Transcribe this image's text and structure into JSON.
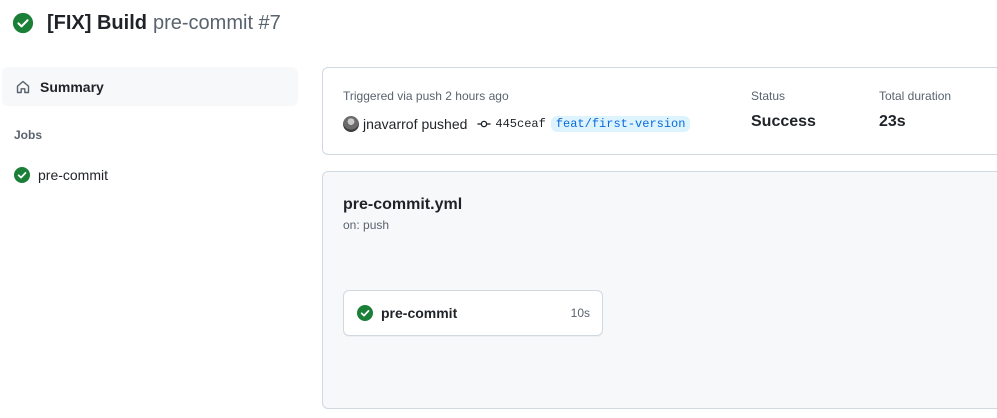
{
  "header": {
    "title": "[FIX] Build",
    "subtitle": "pre-commit #7",
    "status_icon": "check-circle-fill-icon"
  },
  "sidebar": {
    "summary_label": "Summary",
    "jobs_heading": "Jobs",
    "jobs": [
      {
        "label": "pre-commit",
        "status": "success"
      }
    ]
  },
  "summary": {
    "triggered_text": "Triggered via push 2 hours ago",
    "actor": "jnavarrof",
    "action": "pushed",
    "commit_sha": "445ceaf",
    "branch": "feat/first-version",
    "status_label": "Status",
    "status_value": "Success",
    "duration_label": "Total duration",
    "duration_value": "23s"
  },
  "graph": {
    "workflow_file": "pre-commit.yml",
    "trigger": "on: push",
    "job": {
      "name": "pre-commit",
      "duration": "10s",
      "status": "success"
    }
  },
  "colors": {
    "success": "#1a7f37",
    "branch_bg": "#ddf4ff",
    "branch_text": "#0969da",
    "muted_text": "#59636e",
    "border": "#d1d9e0",
    "panel_bg": "#f6f8fa"
  }
}
